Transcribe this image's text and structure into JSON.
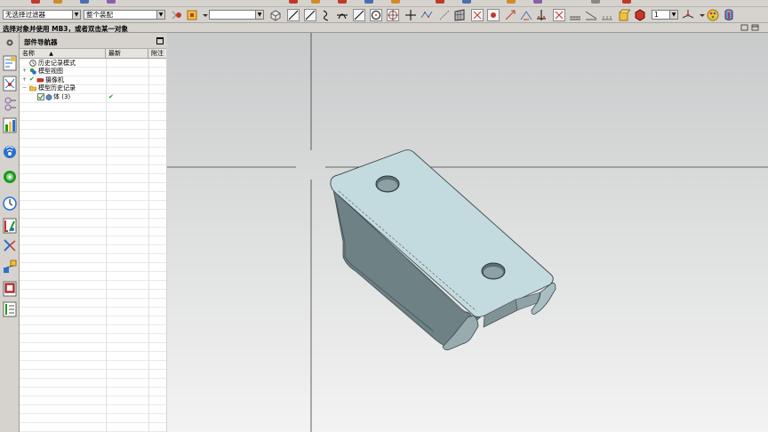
{
  "toolbar": {
    "selection_filter": "无选择过滤器",
    "assembly_scope": "整个装配",
    "layer_value": "",
    "number_value": "1"
  },
  "status": {
    "prompt": "选择对象并使用 MB3，或者双击某一对象"
  },
  "navigator": {
    "title": "部件导航器",
    "columns": {
      "name": "名称",
      "latest": "最新",
      "attachment": "附注"
    },
    "items": [
      {
        "label": "历史记录模式",
        "expander": "",
        "checked": false,
        "icon": "clock-icon",
        "latest": ""
      },
      {
        "label": "模型视图",
        "expander": "+",
        "checked": false,
        "icon": "views-icon",
        "latest": ""
      },
      {
        "label": "摄像机",
        "expander": "+",
        "checked": true,
        "icon": "camera-icon",
        "latest": ""
      },
      {
        "label": "模型历史记录",
        "expander": "−",
        "checked": false,
        "icon": "folder-icon",
        "latest": ""
      },
      {
        "label": "体 (3)",
        "expander": "",
        "checked": true,
        "icon": "body-icon",
        "latest": "✔"
      }
    ]
  },
  "icons": {
    "toolbar": [
      "point-icon",
      "snap-icon",
      "view-orient-icon",
      "line-icon",
      "line-icon",
      "curve-icon",
      "arc-icon",
      "line-icon",
      "circle-icon",
      "circle-icon",
      "point-set-icon",
      "spline-icon",
      "mesh-icon",
      "analysis-icon",
      "measure-icon",
      "grid-icon",
      "ruler-icon",
      "color-icon",
      "display-icon",
      "render-icon"
    ],
    "resource_bar": [
      "settings-icon",
      "part-navigator-icon",
      "assembly-navigator-icon",
      "constraint-icon",
      "roles-icon",
      "history-icon",
      "web-icon",
      "clock-icon",
      "palette-icon",
      "reuse-icon",
      "process-icon",
      "layers-icon",
      "list-icon"
    ]
  },
  "colors": {
    "part_top": "#c3dbdf",
    "part_side": "#67797c",
    "viewport_top": "#c9cacb",
    "viewport_bottom": "#f3f3f3",
    "check_green": "#1a9a1a"
  }
}
